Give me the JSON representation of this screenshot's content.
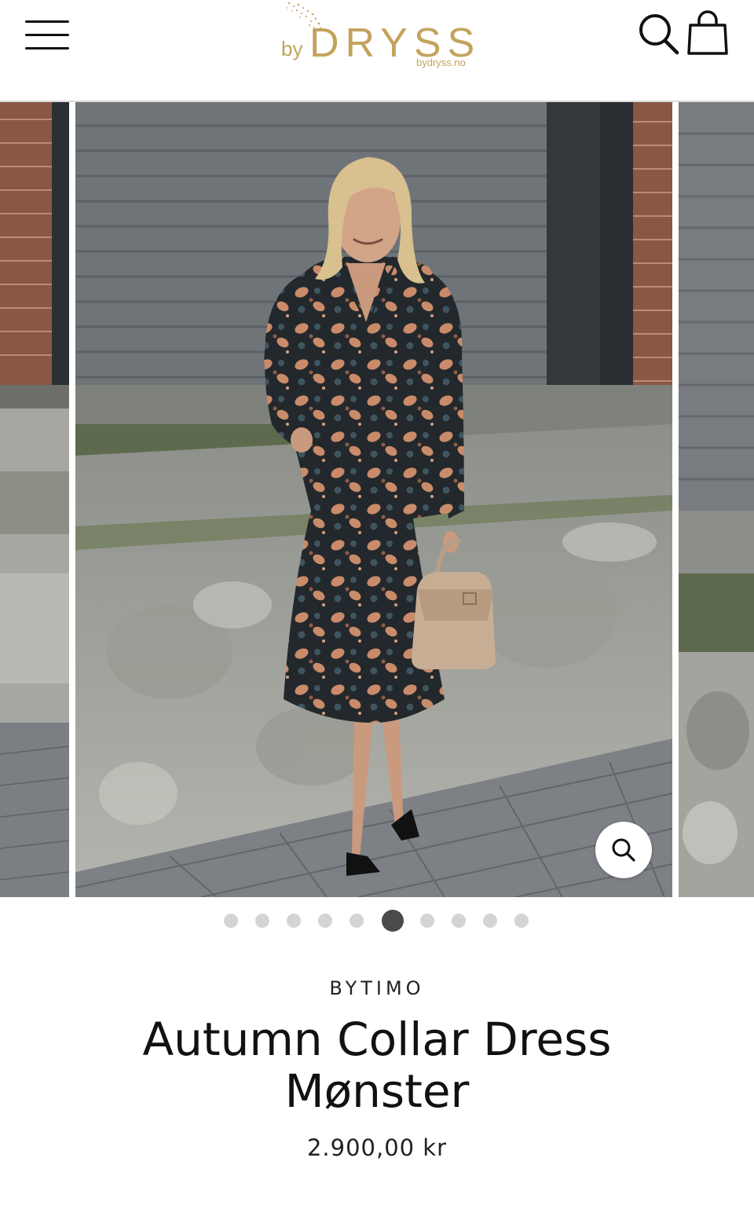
{
  "header": {
    "logo_prefix": "by",
    "logo_word": "DRYSS",
    "logo_url": "bydryss.no",
    "brand_color": "#c3a35c",
    "menu_icon": "hamburger-menu-icon",
    "search_icon": "search-icon",
    "cart_icon": "shopping-bag-icon"
  },
  "gallery": {
    "image_count": 10,
    "active_index": 5,
    "zoom_icon": "zoom-icon"
  },
  "product": {
    "brand": "BYTIMO",
    "title_line1": "Autumn Collar Dress",
    "title_line2": "Mønster",
    "price": "2.900,00 kr"
  }
}
